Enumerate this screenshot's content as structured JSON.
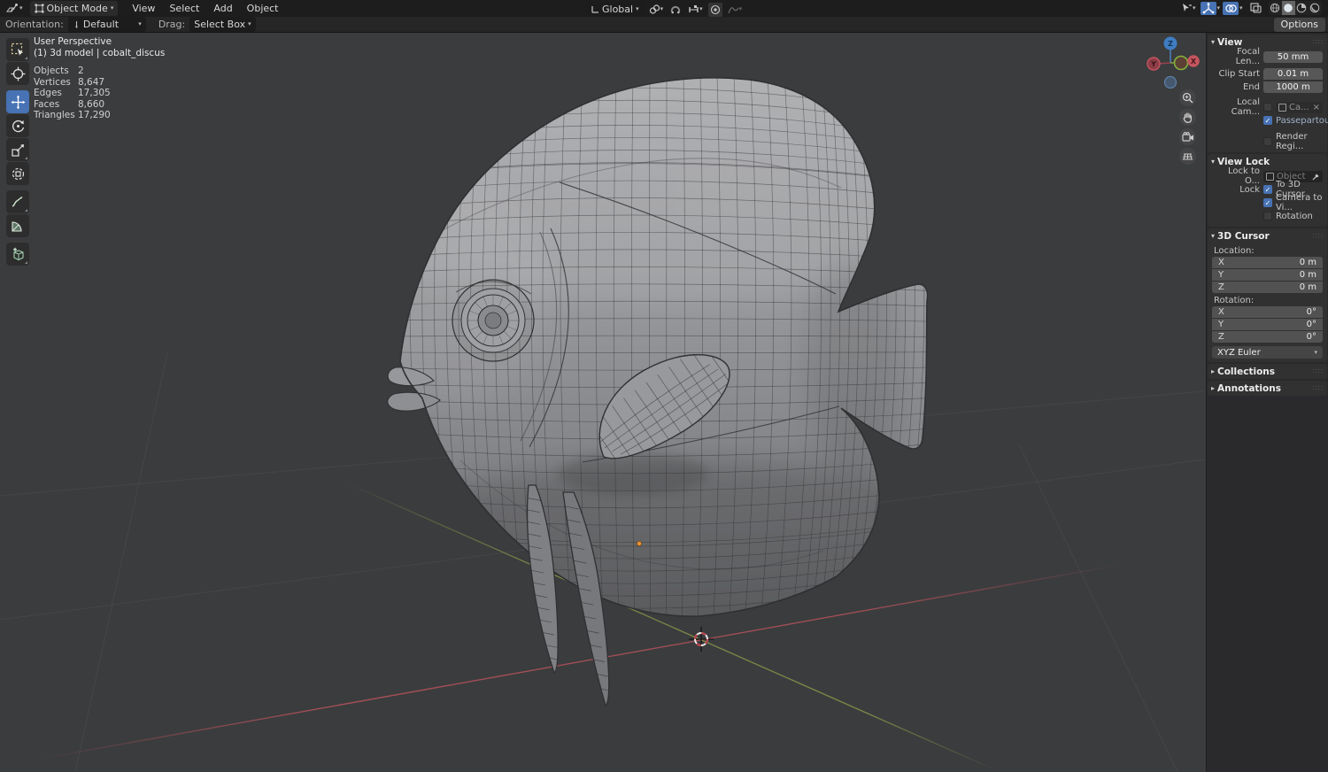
{
  "topbar": {
    "mode": "Object Mode",
    "menus": [
      "View",
      "Select",
      "Add",
      "Object"
    ],
    "orientation_value": "Global",
    "options_label": "Options",
    "row2": {
      "orientation_label": "Orientation:",
      "orientation_field": "Default",
      "drag_label": "Drag:",
      "drag_field": "Select Box"
    }
  },
  "overlay": {
    "line1": "User Perspective",
    "line2": "(1) 3d model | cobalt_discus",
    "stats": [
      {
        "label": "Objects",
        "value": "2"
      },
      {
        "label": "Vertices",
        "value": "8,647"
      },
      {
        "label": "Edges",
        "value": "17,305"
      },
      {
        "label": "Faces",
        "value": "8,660"
      },
      {
        "label": "Triangles",
        "value": "17,290"
      }
    ]
  },
  "gizmo": {
    "x": "X",
    "y": "Y",
    "z": "Z"
  },
  "panel": {
    "view": {
      "title": "View",
      "focal_label": "Focal Len...",
      "focal_value": "50 mm",
      "clip_start_label": "Clip Start",
      "clip_start_value": "0.01 m",
      "end_label": "End",
      "end_value": "1000 m",
      "local_cam_label": "Local Cam...",
      "local_cam_value": "Ca...",
      "passepartout_label": "Passepartout",
      "render_region_label": "Render Regi..."
    },
    "view_lock": {
      "title": "View Lock",
      "lock_to_label": "Lock to O...",
      "lock_to_placeholder": "Object",
      "lock_label": "Lock",
      "to_3d_cursor": "To 3D Cursor",
      "camera_to_view": "Camera to Vi...",
      "rotation": "Rotation"
    },
    "cursor3d": {
      "title": "3D Cursor",
      "location_label": "Location:",
      "rotation_label": "Rotation:",
      "axes": [
        "X",
        "Y",
        "Z"
      ],
      "location_values": [
        "0 m",
        "0 m",
        "0 m"
      ],
      "rotation_values": [
        "0°",
        "0°",
        "0°"
      ],
      "euler": "XYZ Euler"
    },
    "collections_title": "Collections",
    "annotations_title": "Annotations"
  },
  "colors": {
    "accent_blue": "#4772b3",
    "axis_red": "#c4555e",
    "axis_green": "#9aa649",
    "origin_orange": "#e8953c"
  }
}
